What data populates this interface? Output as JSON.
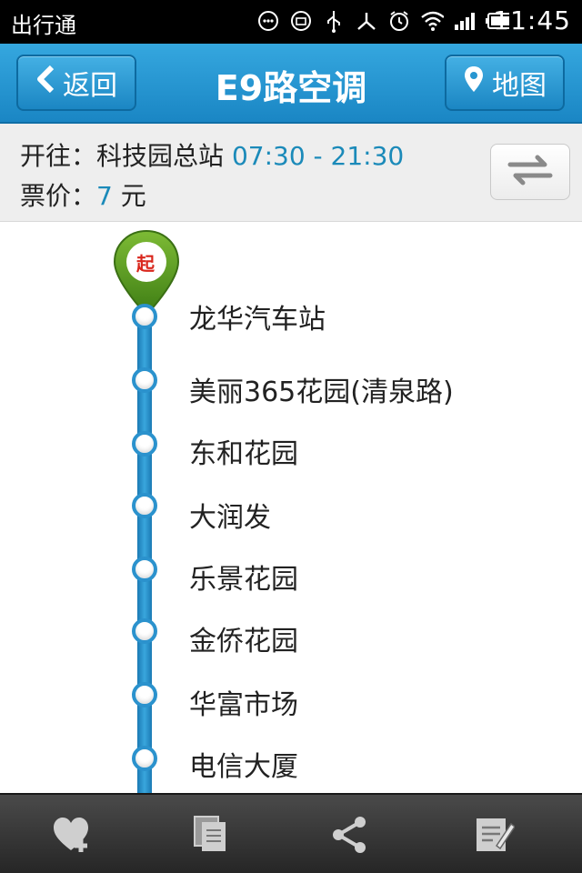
{
  "status": {
    "app_name": "出行通",
    "time": "11:45"
  },
  "header": {
    "back_label": "返回",
    "title": "E9路空调",
    "map_label": "地图"
  },
  "info": {
    "direction_label": "开往：",
    "terminus": "科技园总站",
    "hours": "07:30 - 21:30",
    "fare_label": "票价：",
    "fare_value": "7",
    "fare_unit": "元"
  },
  "route": {
    "start_badge": "起",
    "stops": [
      "龙华汽车站",
      "美丽365花园(清泉路)",
      "东和花园",
      "大润发",
      "乐景花园",
      "金侨花园",
      "华富市场",
      "电信大厦"
    ]
  },
  "toolbar": {
    "items": [
      "favorite-add",
      "copy",
      "share",
      "edit"
    ]
  },
  "colors": {
    "accent": "#1b8ab9",
    "topbar": "#2796d1",
    "pin_green": "#5a9b22",
    "start_red": "#d9261c"
  }
}
